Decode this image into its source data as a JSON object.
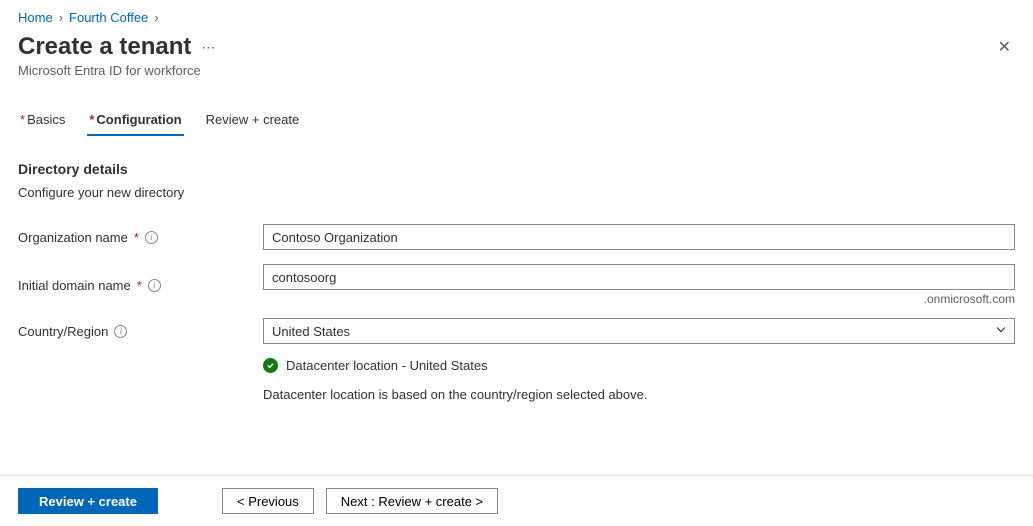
{
  "breadcrumb": {
    "home": "Home",
    "parent": "Fourth Coffee"
  },
  "header": {
    "title": "Create a tenant",
    "subtitle": "Microsoft Entra ID for workforce"
  },
  "tabs": {
    "basics": "Basics",
    "configuration": "Configuration",
    "review": "Review + create"
  },
  "section": {
    "title": "Directory details",
    "desc": "Configure your new directory"
  },
  "form": {
    "org_label": "Organization name",
    "org_value": "Contoso Organization",
    "domain_label": "Initial domain name",
    "domain_value": "contosoorg",
    "domain_suffix": ".onmicrosoft.com",
    "country_label": "Country/Region",
    "country_value": "United States",
    "dc_location": "Datacenter location - United States",
    "dc_note": "Datacenter location is based on the country/region selected above."
  },
  "footer": {
    "primary": "Review + create",
    "prev": "< Previous",
    "next": "Next : Review + create >"
  }
}
